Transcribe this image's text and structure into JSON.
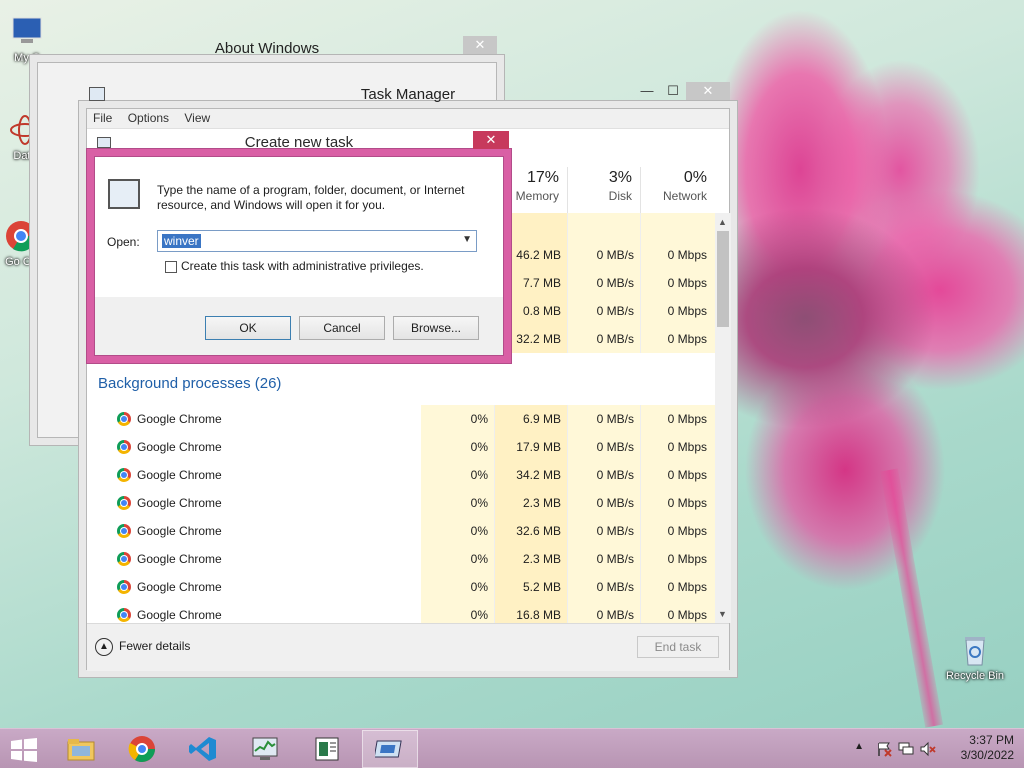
{
  "desktop": {
    "icons": [
      {
        "id": "my-computer",
        "label": "My C"
      },
      {
        "id": "data",
        "label": "Data"
      },
      {
        "id": "google-chrome",
        "label": "Go\nCh"
      },
      {
        "id": "recycle-bin",
        "label": "Recycle Bin"
      }
    ]
  },
  "about_window": {
    "title": "About Windows",
    "close": "✕"
  },
  "task_manager": {
    "title": "Task Manager",
    "controls": {
      "minimize": "—",
      "maximize": "☐",
      "close": "✕"
    },
    "menu": [
      "File",
      "Options",
      "View"
    ],
    "columns": [
      {
        "pct": "17%",
        "label": "Memory"
      },
      {
        "pct": "3%",
        "label": "Disk"
      },
      {
        "pct": "0%",
        "label": "Network"
      }
    ],
    "app_rows": [
      {
        "memory": "46.2 MB",
        "disk": "0 MB/s",
        "network": "0 Mbps"
      },
      {
        "memory": "7.7 MB",
        "disk": "0 MB/s",
        "network": "0 Mbps"
      },
      {
        "memory": "0.8 MB",
        "disk": "0 MB/s",
        "network": "0 Mbps"
      },
      {
        "memory": "32.2 MB",
        "disk": "0 MB/s",
        "network": "0 Mbps"
      }
    ],
    "background_title": "Background processes (26)",
    "processes": [
      {
        "name": "Google Chrome",
        "cpu": "0%",
        "memory": "6.9 MB",
        "disk": "0 MB/s",
        "network": "0 Mbps"
      },
      {
        "name": "Google Chrome",
        "cpu": "0%",
        "memory": "17.9 MB",
        "disk": "0 MB/s",
        "network": "0 Mbps"
      },
      {
        "name": "Google Chrome",
        "cpu": "0%",
        "memory": "34.2 MB",
        "disk": "0 MB/s",
        "network": "0 Mbps"
      },
      {
        "name": "Google Chrome",
        "cpu": "0%",
        "memory": "2.3 MB",
        "disk": "0 MB/s",
        "network": "0 Mbps"
      },
      {
        "name": "Google Chrome",
        "cpu": "0%",
        "memory": "32.6 MB",
        "disk": "0 MB/s",
        "network": "0 Mbps"
      },
      {
        "name": "Google Chrome",
        "cpu": "0%",
        "memory": "2.3 MB",
        "disk": "0 MB/s",
        "network": "0 Mbps"
      },
      {
        "name": "Google Chrome",
        "cpu": "0%",
        "memory": "5.2 MB",
        "disk": "0 MB/s",
        "network": "0 Mbps"
      },
      {
        "name": "Google Chrome",
        "cpu": "0%",
        "memory": "16.8 MB",
        "disk": "0 MB/s",
        "network": "0 Mbps"
      }
    ],
    "fewer_details": "Fewer details",
    "end_task": "End task"
  },
  "create_task_dialog": {
    "title": "Create new task",
    "close": "✕",
    "description": "Type the name of a program, folder, document, or Internet resource, and Windows will open it for you.",
    "open_label": "Open:",
    "open_value": "winver",
    "admin_checkbox_label": "Create this task with administrative privileges.",
    "admin_checked": false,
    "ok": "OK",
    "cancel": "Cancel",
    "browse": "Browse..."
  },
  "taskbar": {
    "items": [
      "start",
      "file-explorer",
      "google-chrome",
      "visual-studio-code",
      "task-manager",
      "document-viewer",
      "run-dialog"
    ],
    "active": "run-dialog",
    "clock": {
      "time": "3:37 PM",
      "date": "3/30/2022"
    },
    "tray_icons": [
      "show-hidden-icons",
      "action-center-icon",
      "network-icon",
      "volume-muted-icon"
    ]
  }
}
